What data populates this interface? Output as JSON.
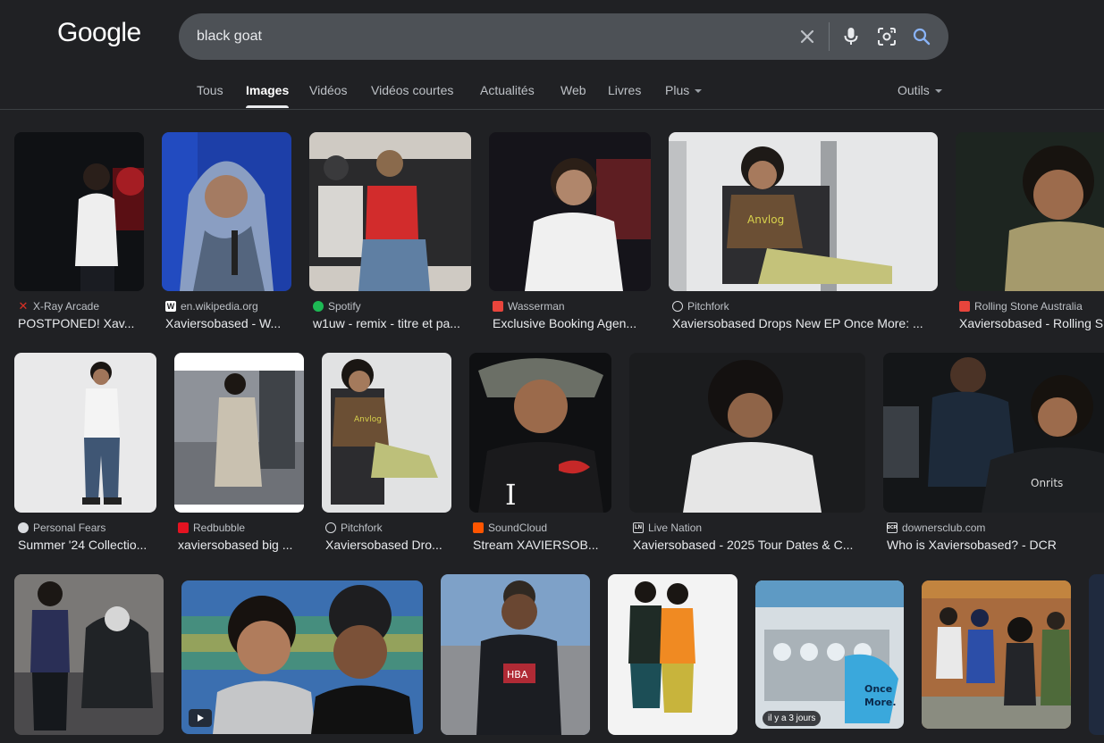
{
  "logo": "Google",
  "search": {
    "query": "black goat"
  },
  "tabs": [
    {
      "label": "Tous",
      "active": false
    },
    {
      "label": "Images",
      "active": true
    },
    {
      "label": "Vidéos",
      "active": false
    },
    {
      "label": "Vidéos courtes",
      "active": false
    },
    {
      "label": "Actualités",
      "active": false
    },
    {
      "label": "Web",
      "active": false
    },
    {
      "label": "Livres",
      "active": false
    },
    {
      "label": "Plus",
      "active": false
    }
  ],
  "tools_label": "Outils",
  "results": [
    {
      "source": "X-Ray Arcade",
      "title": "POSTPONED! Xav...",
      "favicon": "x-icon",
      "fav_color": "#d93025"
    },
    {
      "source": "en.wikipedia.org",
      "title": "Xaviersobased - W...",
      "favicon": "wikipedia-icon",
      "fav_color": "#ffffff"
    },
    {
      "source": "Spotify",
      "title": "w1uw - remix - titre et pa...",
      "favicon": "spotify-icon",
      "fav_color": "#1db954"
    },
    {
      "source": "Wasserman",
      "title": "Exclusive Booking Agen...",
      "favicon": "wasserman-icon",
      "fav_color": "#e8453c"
    },
    {
      "source": "Pitchfork",
      "title": "Xaviersobased Drops New EP Once More: ...",
      "favicon": "pitchfork-icon",
      "fav_color": "#dadce0"
    },
    {
      "source": "Rolling Stone Australia",
      "title": "Xaviersobased - Rolling S",
      "favicon": "rolling-stone-icon",
      "fav_color": "#e8453c"
    },
    {
      "source": "Personal Fears",
      "title": "Summer '24 Collectio...",
      "favicon": "personal-fears-icon",
      "fav_color": "#dadce0"
    },
    {
      "source": "Redbubble",
      "title": "xaviersobased big ...",
      "favicon": "redbubble-icon",
      "fav_color": "#e41321"
    },
    {
      "source": "Pitchfork",
      "title": "Xaviersobased Dro...",
      "favicon": "pitchfork-icon",
      "fav_color": "#dadce0"
    },
    {
      "source": "SoundCloud",
      "title": "Stream XAVIERSOB...",
      "favicon": "soundcloud-icon",
      "fav_color": "#ff5500"
    },
    {
      "source": "Live Nation",
      "title": "Xaviersobased - 2025 Tour Dates & C...",
      "favicon": "live-nation-icon",
      "fav_color": "#202124"
    },
    {
      "source": "downersclub.com",
      "title": "Who is Xaviersobased? - DCR",
      "favicon": "downersclub-icon",
      "fav_color": "#202124"
    }
  ],
  "row3_badge": "il y a 3 jours"
}
